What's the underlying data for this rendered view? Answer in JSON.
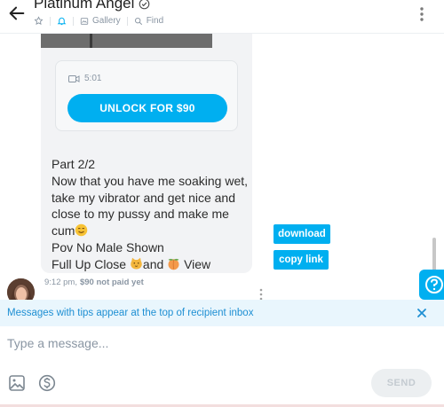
{
  "header": {
    "title": "Platinum Angel",
    "gallery_label": "Gallery",
    "find_label": "Find"
  },
  "locked_media": {
    "duration": "5:01",
    "unlock_label": "UNLOCK FOR $90"
  },
  "message": {
    "line1": "Part 2/2",
    "line2": "Now that you have me soaking wet, take my vibrator and get nice and close to my pussy and make me cum",
    "line3": "Pov No Male Shown",
    "line4_a": "Full Up Close ",
    "line4_b": "and ",
    "line4_c": "View",
    "time": "9:12 pm,",
    "price_status": "$90 not paid yet"
  },
  "actions": {
    "download_label": "download",
    "copy_link_label": "copy link"
  },
  "notice": {
    "text": "Messages with tips appear at the top of recipient inbox"
  },
  "composer": {
    "placeholder": "Type a message...",
    "send_label": "SEND"
  },
  "colors": {
    "accent": "#00aff0",
    "notice_bg": "#e9f6fd",
    "notice_text": "#1e8fd3"
  }
}
